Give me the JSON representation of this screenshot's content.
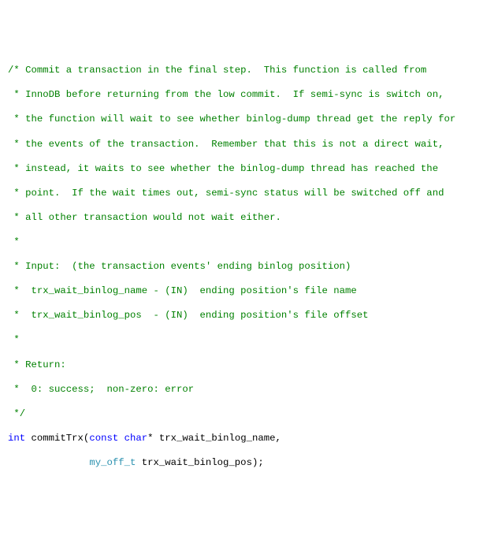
{
  "code": {
    "c01": "/* Commit a transaction in the final step.  This function is called from",
    "c02": " * InnoDB before returning from the low commit.  If semi-sync is switch on,",
    "c03": " * the function will wait to see whether binlog-dump thread get the reply for",
    "c04": " * the events of the transaction.  Remember that this is not a direct wait,",
    "c05": " * instead, it waits to see whether the binlog-dump thread has reached the",
    "c06": " * point.  If the wait times out, semi-sync status will be switched off and",
    "c07": " * all other transaction would not wait either.",
    "c08": " *",
    "c09": " * Input:  (the transaction events' ending binlog position)",
    "c10": " *  trx_wait_binlog_name - (IN)  ending position's file name",
    "c11": " *  trx_wait_binlog_pos  - (IN)  ending position's file offset",
    "c12": " *",
    "c13": " * Return:",
    "c14": " *  0: success;  non-zero: error",
    "c15": " */",
    "kw_int": "int",
    "fn_name": " commitTrx(",
    "kw_const": "const",
    "kw_char": "char",
    "arg1": "* trx_wait_binlog_name,",
    "indent2": "              ",
    "type_my_off_t": "my_off_t",
    "arg2": " trx_wait_binlog_pos);"
  }
}
